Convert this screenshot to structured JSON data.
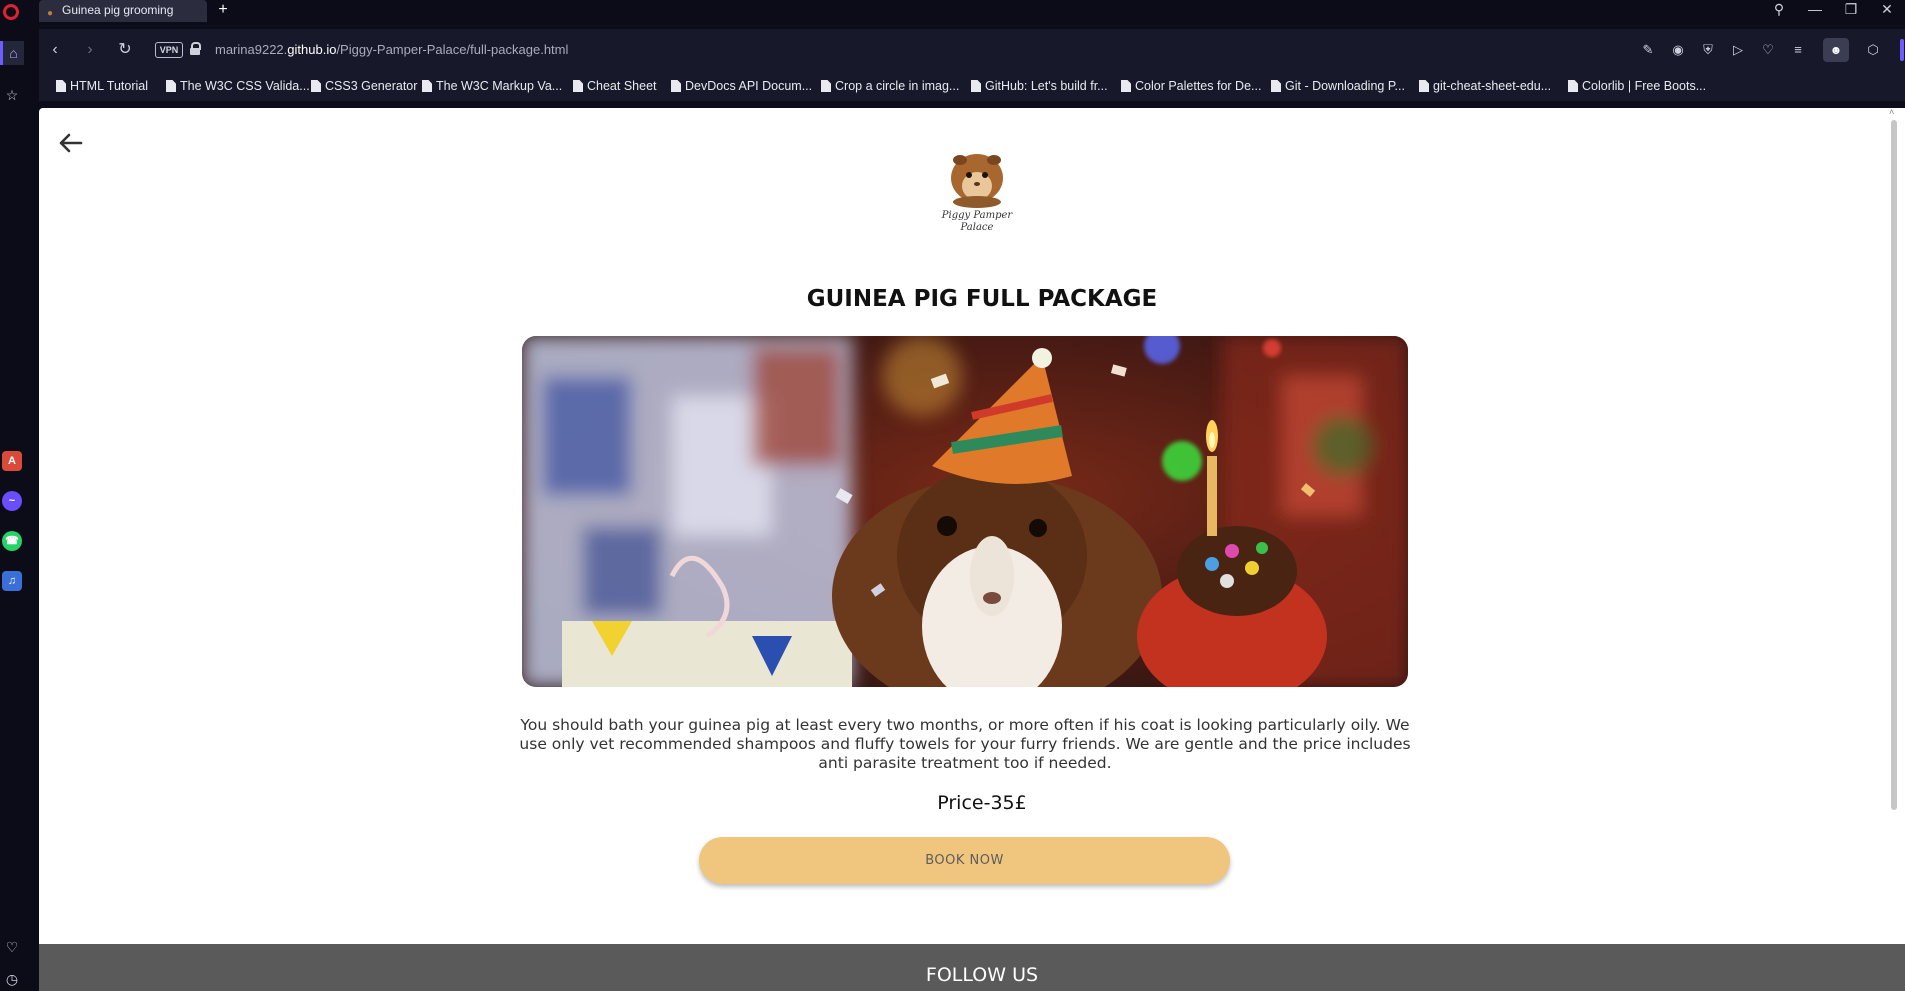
{
  "browser": {
    "tab_title": "Guinea pig grooming",
    "new_tab_symbol": "+",
    "vpn_badge": "VPN",
    "url_prefix": "marina9222.",
    "url_domain": "github.io",
    "url_path": "/Piggy-Pamper-Palace/full-package.html",
    "accent_color": "#6f5cff",
    "bookmarks": [
      "HTML Tutorial",
      "The W3C CSS Valida...",
      "CSS3 Generator",
      "The W3C Markup Va...",
      "Cheat Sheet",
      "DevDocs API Docum...",
      "Crop a circle in imag...",
      "GitHub: Let's build fr...",
      "Color Palettes for De...",
      "Git - Downloading P...",
      "git-cheat-sheet-edu...",
      "Colorlib | Free Boots..."
    ],
    "icons": {
      "back": "chevron-left-icon",
      "forward": "chevron-right-icon",
      "reload": "reload-icon",
      "search": "search-icon",
      "minimize": "minimize-icon",
      "restore": "restore-icon",
      "close": "close-icon"
    }
  },
  "page": {
    "logo_text_line1": "Piggy Pamper",
    "logo_text_line2": "Palace",
    "title": "GUINEA PIG FULL PACKAGE",
    "description": "You should bath your guinea pig at least every two months, or more often if his coat is looking particularly oily. We use only vet recommended shampoos and fluffy towels for your furry friends. We are gentle and the price includes anti parasite treatment too if needed.",
    "price": "Price-35£",
    "book_button": "BOOK NOW",
    "book_button_color": "#f0c67e",
    "footer_title": "FOLLOW US",
    "footer_color": "#5a5a5a"
  }
}
